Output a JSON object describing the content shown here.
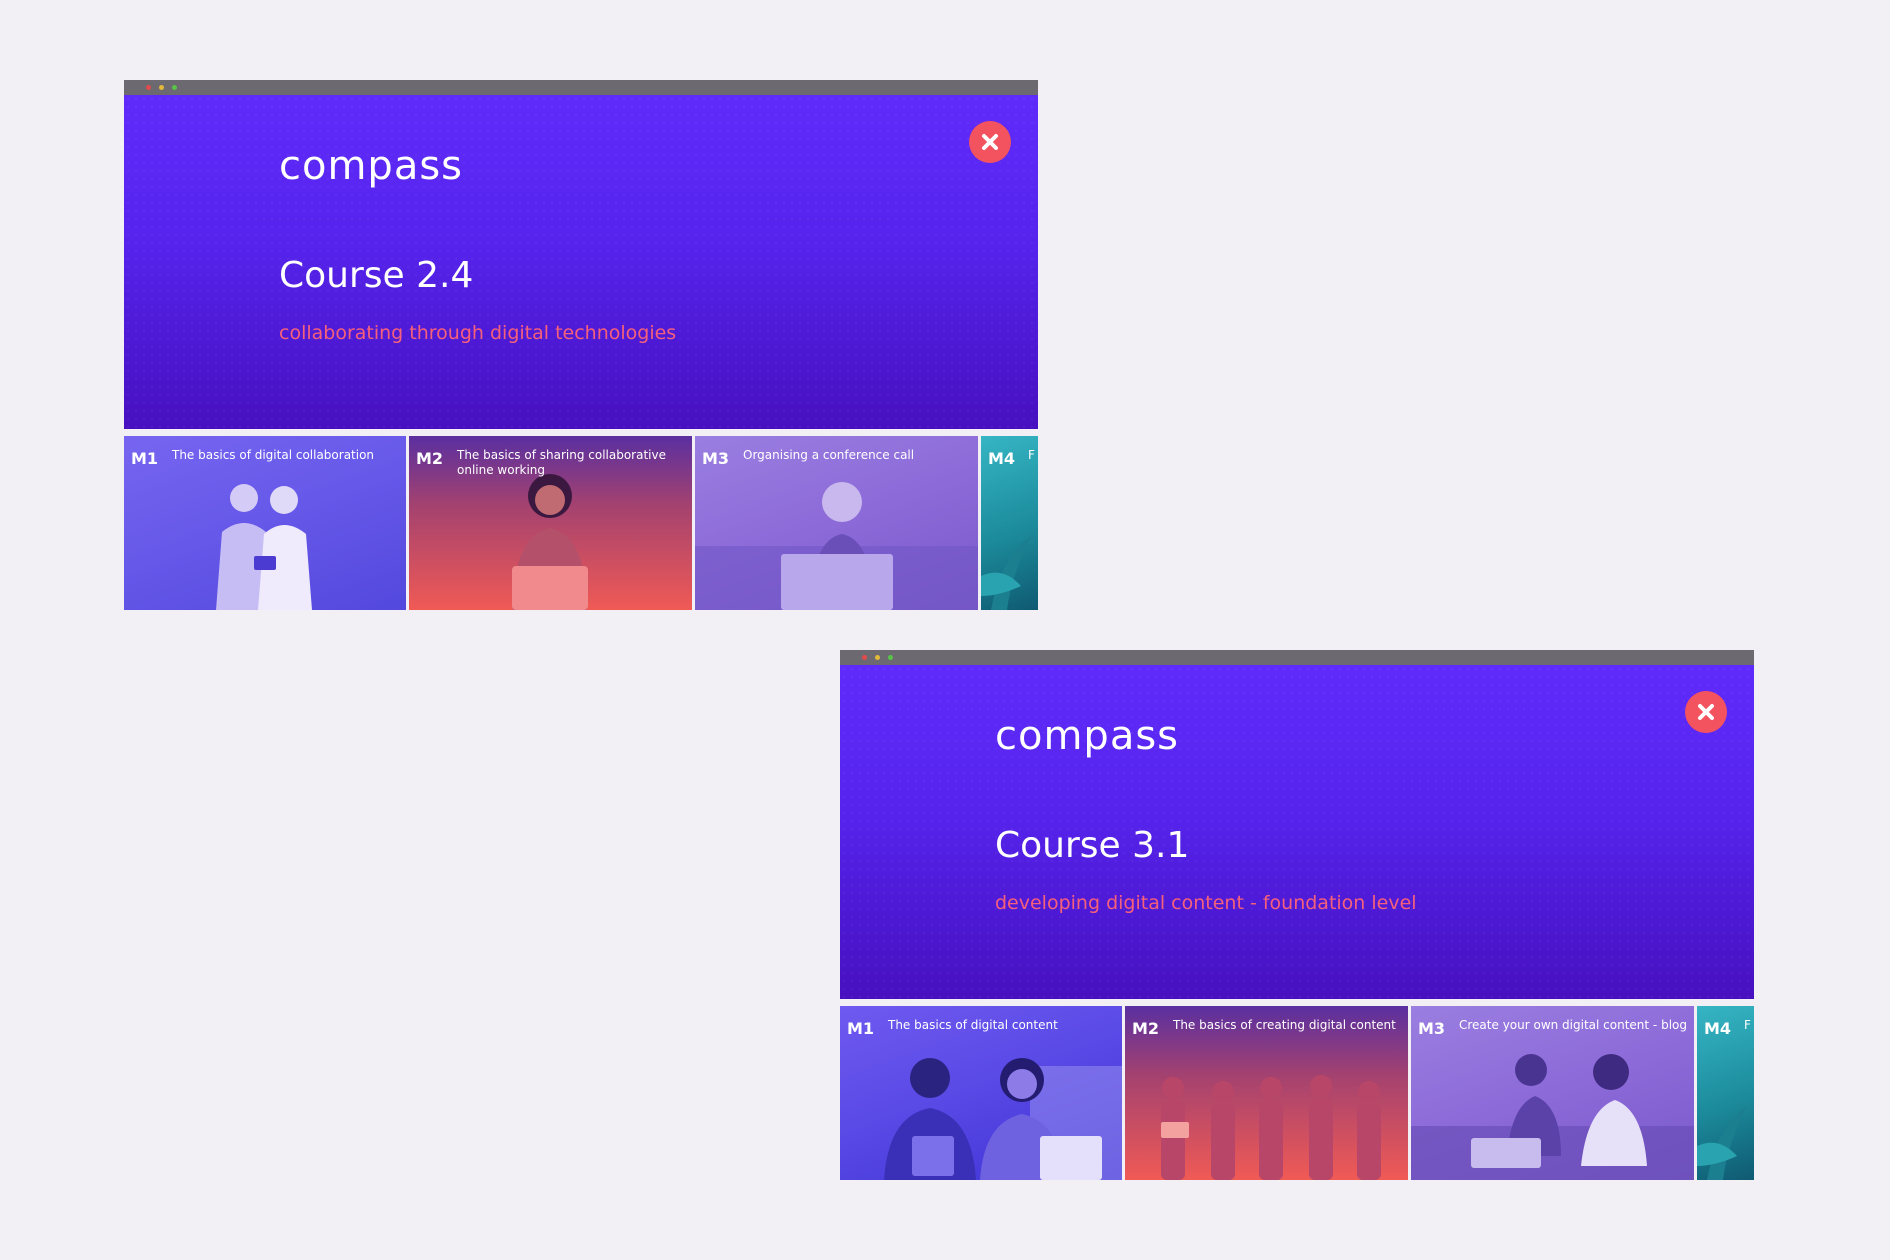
{
  "colors": {
    "background": "#f2f0f4",
    "chrome": "#6c6a70",
    "hero_top": "#5f2bfb",
    "hero_bottom": "#4710bf",
    "accent": "#f5607a",
    "close": "#f3525f",
    "dot_red": "#e24b4b",
    "dot_yellow": "#e3b93a",
    "dot_green": "#58c447"
  },
  "windows": [
    {
      "logo": "compass",
      "course_title": "Course 2.4",
      "course_subtitle": "collaborating through digital technologies",
      "close_icon": "close-x-icon",
      "modules": [
        {
          "code": "M1",
          "title": "The basics of digital collaboration"
        },
        {
          "code": "M2",
          "title": "The basics of sharing collaborative online working"
        },
        {
          "code": "M3",
          "title": "Organising a conference call"
        },
        {
          "code": "M4",
          "title": "F"
        }
      ]
    },
    {
      "logo": "compass",
      "course_title": "Course 3.1",
      "course_subtitle": "developing digital content - foundation level",
      "close_icon": "close-x-icon",
      "modules": [
        {
          "code": "M1",
          "title": "The basics of digital content"
        },
        {
          "code": "M2",
          "title": "The basics of creating digital content"
        },
        {
          "code": "M3",
          "title": "Create your own digital content - blog"
        },
        {
          "code": "M4",
          "title": "F"
        }
      ]
    }
  ]
}
